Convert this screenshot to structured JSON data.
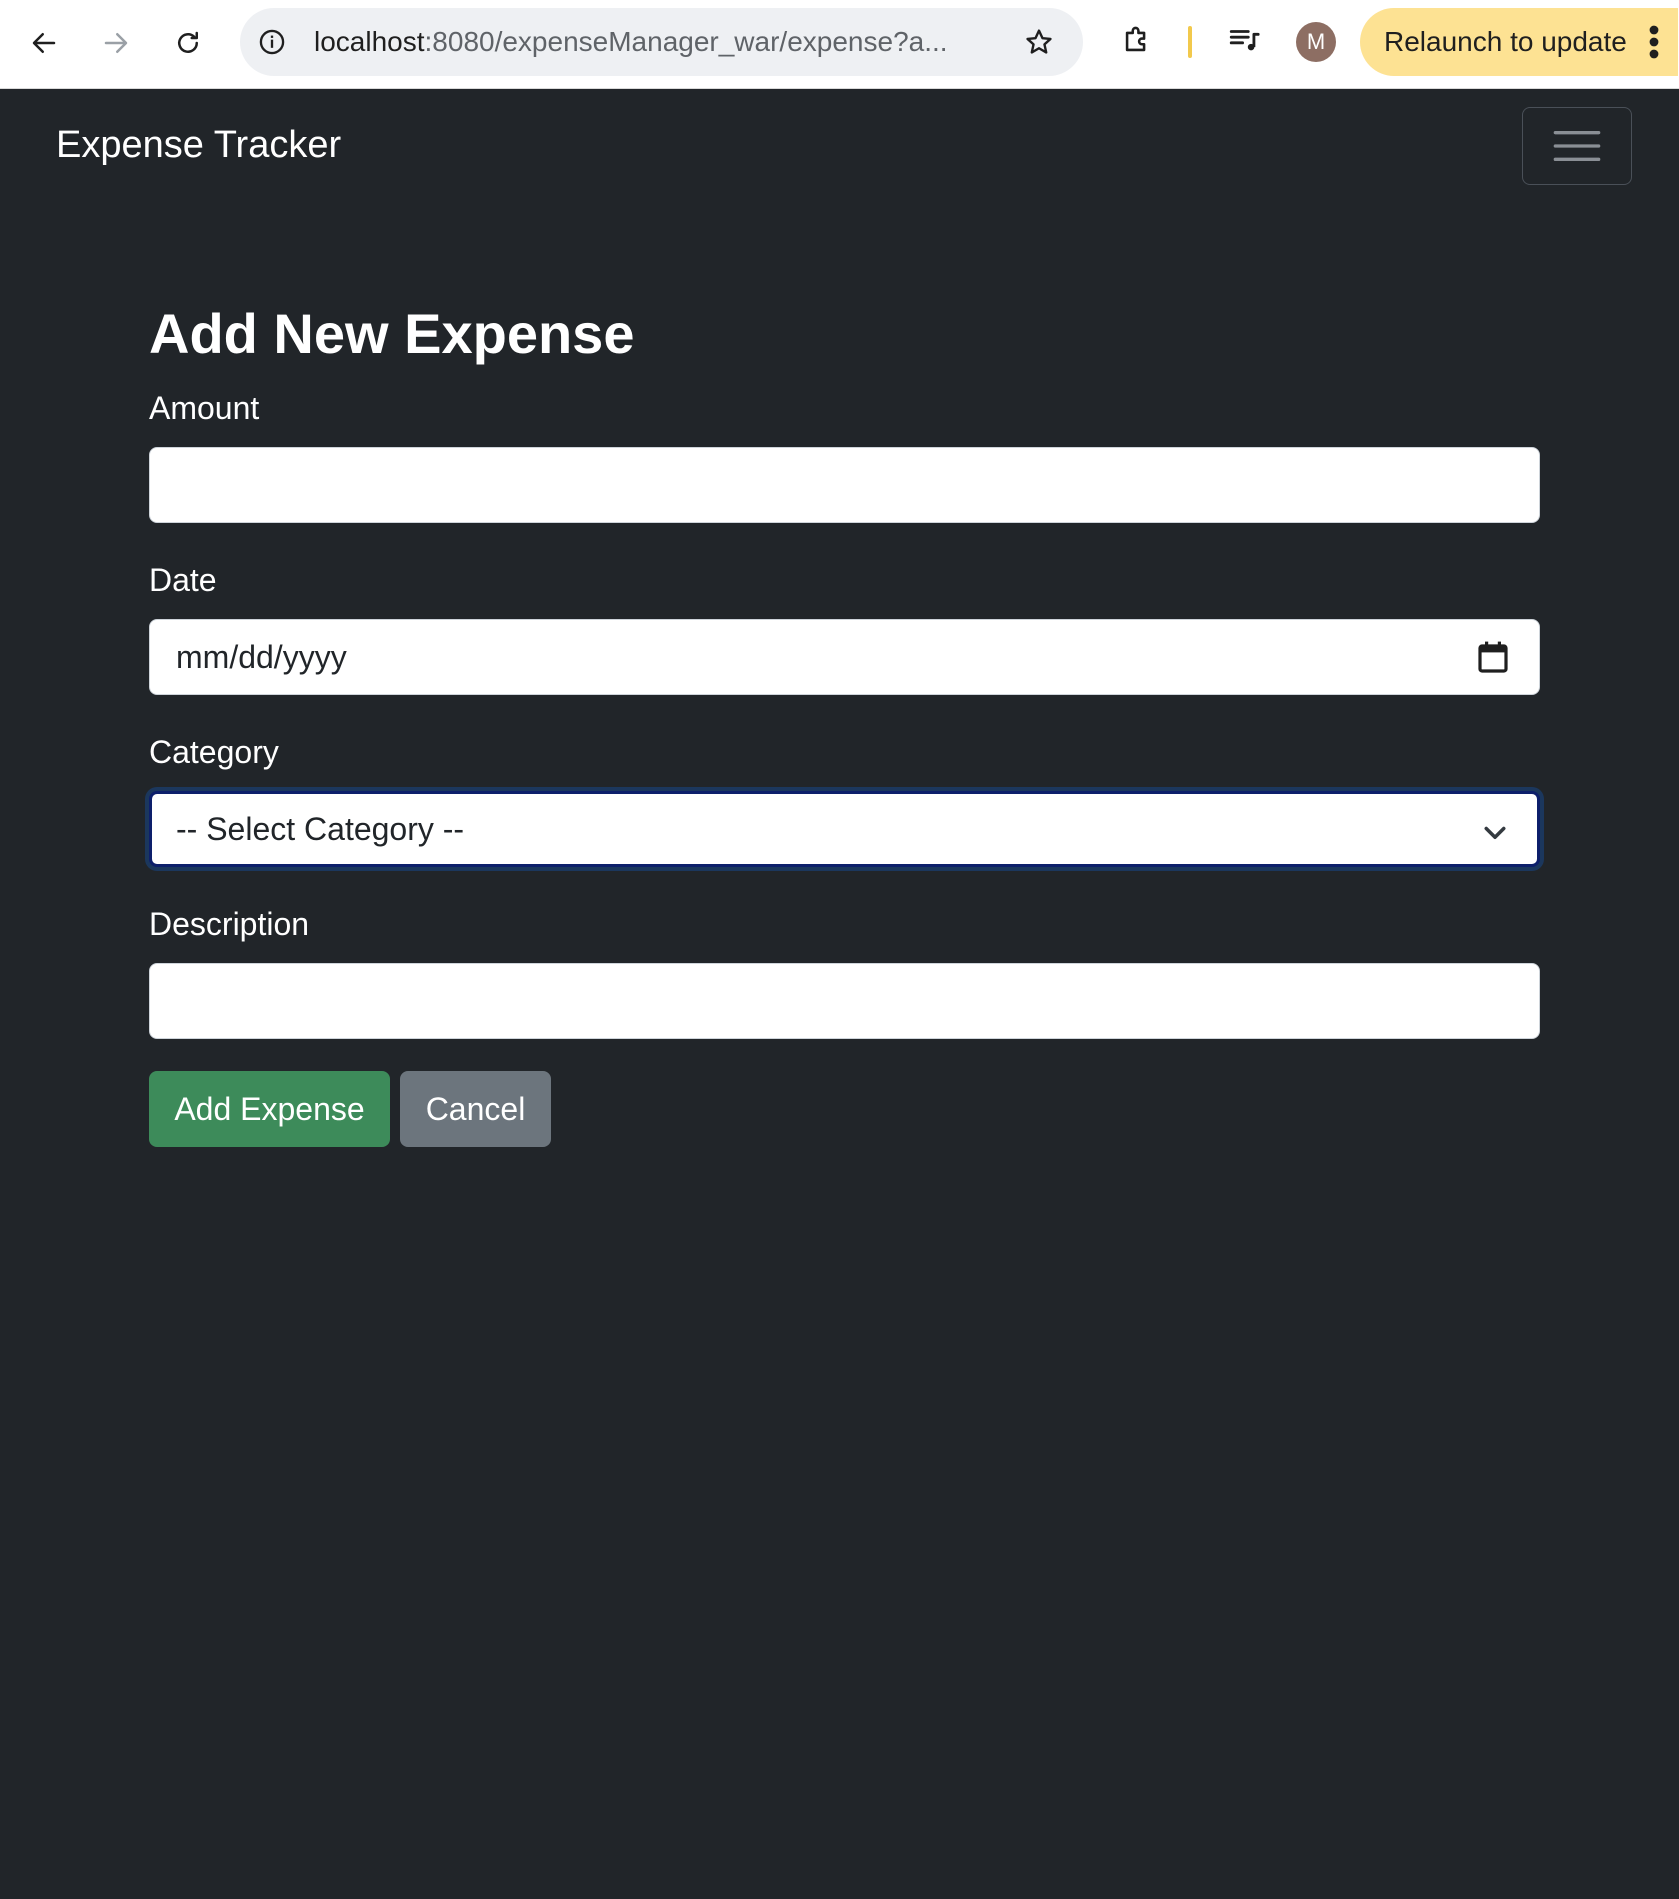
{
  "browser": {
    "url_host": "localhost",
    "url_rest": ":8080/expenseManager_war/expense?a...",
    "relaunch_label": "Relaunch to update",
    "profile_initial": "M"
  },
  "navbar": {
    "brand": "Expense Tracker"
  },
  "form": {
    "title": "Add New Expense",
    "amount_label": "Amount",
    "amount_value": "",
    "date_label": "Date",
    "date_placeholder": "mm/dd/yyyy",
    "category_label": "Category",
    "category_selected": "-- Select Category --",
    "description_label": "Description",
    "description_value": "",
    "submit_label": "Add Expense",
    "cancel_label": "Cancel"
  },
  "colors": {
    "page_bg": "#212529",
    "submit_bg": "#3d8b5a",
    "cancel_bg": "#6c757d",
    "relaunch_bg": "#fde293"
  }
}
